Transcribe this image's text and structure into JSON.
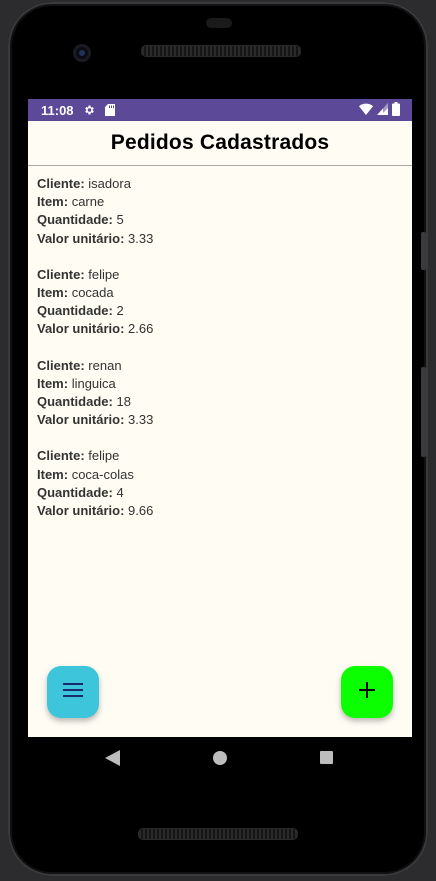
{
  "status_bar": {
    "time": "11:08",
    "color": "#5c4a99",
    "left_icons": [
      "gear-icon",
      "sd-card-icon"
    ],
    "right_icons": [
      "wifi-icon",
      "signal-icon",
      "battery-icon"
    ]
  },
  "header": {
    "title": "Pedidos Cadastrados"
  },
  "labels": {
    "cliente": "Cliente:",
    "item": "Item:",
    "quantidade": "Quantidade:",
    "valor": "Valor unitário:"
  },
  "orders": [
    {
      "cliente": "isadora",
      "item": "carne",
      "quantidade": "5",
      "valor": "3.33"
    },
    {
      "cliente": "felipe",
      "item": "cocada",
      "quantidade": "2",
      "valor": "2.66"
    },
    {
      "cliente": "renan",
      "item": "linguica",
      "quantidade": "18",
      "valor": "3.33"
    },
    {
      "cliente": "felipe",
      "item": "coca-colas",
      "quantidade": "4",
      "valor": "9.66"
    }
  ],
  "fabs": {
    "menu": {
      "icon": "menu-icon",
      "color": "#3cc5db"
    },
    "add": {
      "icon": "plus-icon",
      "color": "#0cff00"
    }
  },
  "navigation": {
    "buttons": [
      "back-icon",
      "home-icon",
      "recents-icon"
    ]
  }
}
